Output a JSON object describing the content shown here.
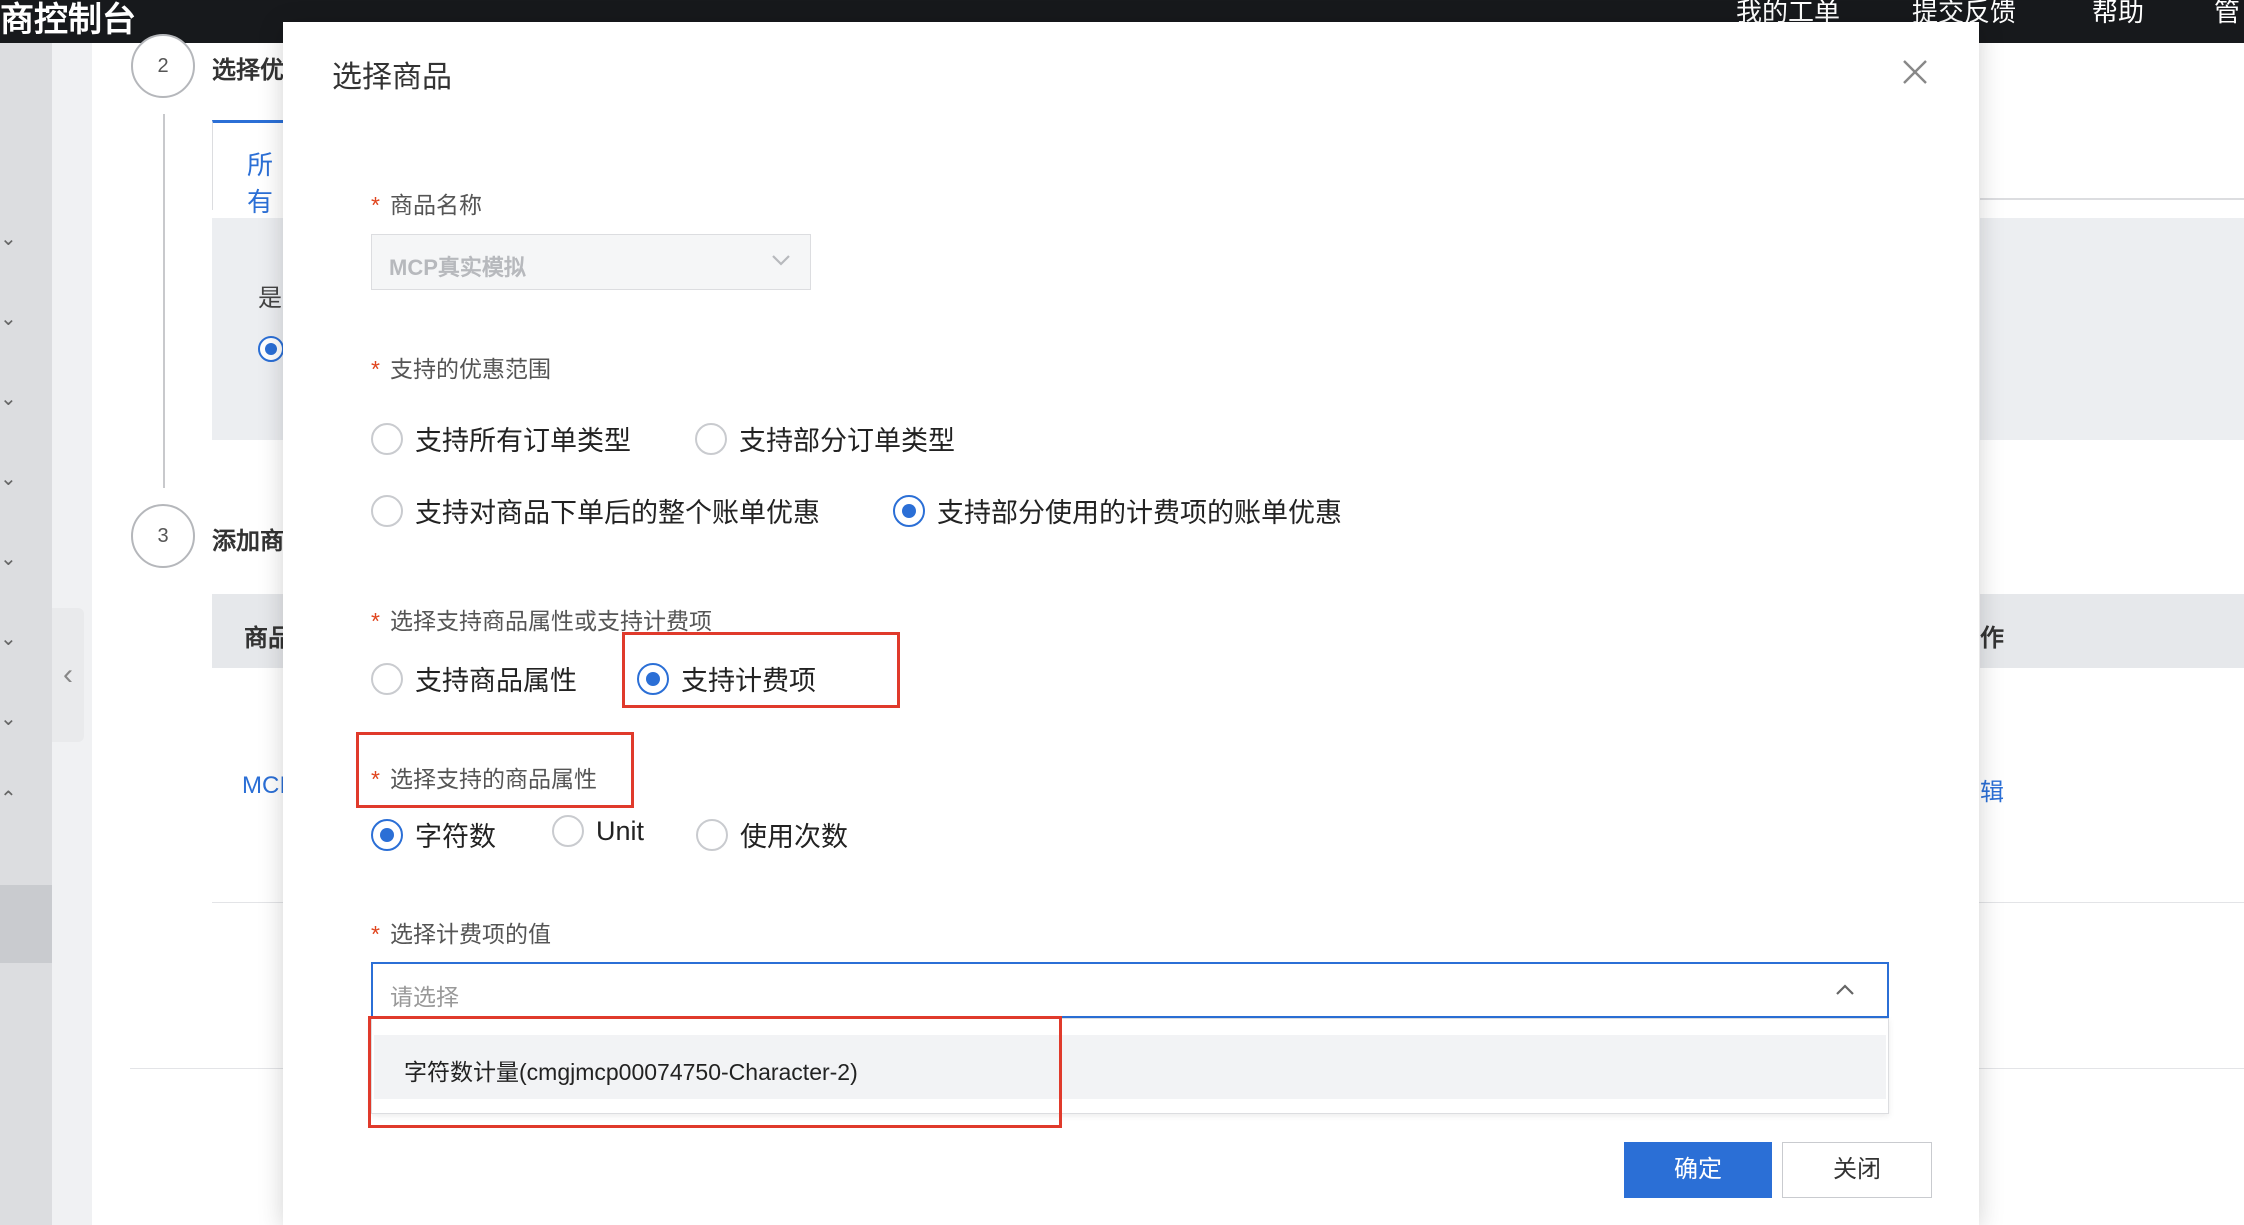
{
  "topbar": {
    "brand": "商控制台",
    "nav": [
      "我的工单",
      "提交反馈",
      "帮助",
      "管"
    ]
  },
  "background": {
    "steps": [
      {
        "number": "2",
        "title": "选择优"
      },
      {
        "number": "3",
        "title": "添加商"
      }
    ],
    "tab_label": "所有",
    "question_label": "是",
    "table_header": "商品",
    "table_header_right": "作",
    "row_link": "MCI",
    "row_action": "辑"
  },
  "dialog": {
    "title": "选择商品",
    "product_name": {
      "label": "商品名称",
      "value": "MCP真实模拟"
    },
    "discount_scope": {
      "label": "支持的优惠范围",
      "options": [
        {
          "label": "支持所有订单类型",
          "checked": false
        },
        {
          "label": "支持部分订单类型",
          "checked": false
        },
        {
          "label": "支持对商品下单后的整个账单优惠",
          "checked": false
        },
        {
          "label": "支持部分使用的计费项的账单优惠",
          "checked": true
        }
      ]
    },
    "attr_or_billing": {
      "label": "选择支持商品属性或支持计费项",
      "options": [
        {
          "label": "支持商品属性",
          "checked": false
        },
        {
          "label": "支持计费项",
          "checked": true
        }
      ]
    },
    "product_attr": {
      "label": "选择支持的商品属性",
      "options": [
        {
          "label": "字符数",
          "checked": true
        },
        {
          "label": "Unit",
          "checked": false
        },
        {
          "label": "使用次数",
          "checked": false
        }
      ]
    },
    "billing_value": {
      "label": "选择计费项的值",
      "placeholder": "请选择",
      "options": [
        "字符数计量(cmgjmcp00074750-Character-2)"
      ]
    },
    "buttons": {
      "confirm": "确定",
      "close": "关闭"
    }
  },
  "colors": {
    "accent": "#2b6fd6",
    "highlight_box": "#e03a2b",
    "required_star": "#e0451e",
    "topbar": "#17191c"
  }
}
